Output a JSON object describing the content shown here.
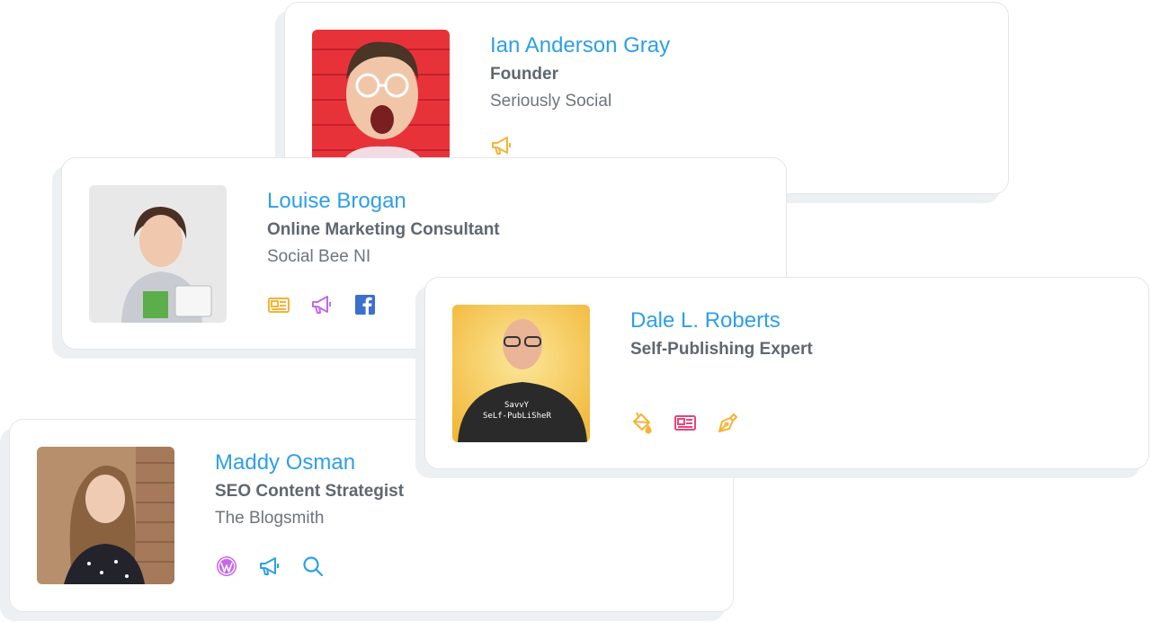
{
  "cards": [
    {
      "name": "Ian Anderson Gray",
      "role": "Founder",
      "company": "Seriously Social",
      "icons": [
        "megaphone-icon"
      ]
    },
    {
      "name": "Louise Brogan",
      "role": "Online Marketing Consultant",
      "company": "Social Bee NI",
      "icons": [
        "newspaper-icon",
        "megaphone-icon",
        "facebook-icon"
      ]
    },
    {
      "name": "Dale L. Roberts",
      "role": "Self-Publishing Expert",
      "company": "",
      "icons": [
        "paint-bucket-icon",
        "newspaper-icon",
        "pen-nib-icon"
      ]
    },
    {
      "name": "Maddy Osman",
      "role": "SEO Content Strategist",
      "company": "The Blogsmith",
      "icons": [
        "wordpress-icon",
        "megaphone-icon",
        "search-icon"
      ]
    }
  ],
  "colors": {
    "name": "#2e9fe6",
    "orange": "#f5b335",
    "purple": "#c468e8",
    "blue": "#2e9fe6",
    "pink": "#e8457d",
    "facebook": "#3b6fd0"
  },
  "photos": {
    "ian_bg": "#e8323a",
    "louise_bg": "#e8e8e8",
    "dale_bg": "#f2c24a",
    "maddy_bg": "#b88f6c"
  }
}
